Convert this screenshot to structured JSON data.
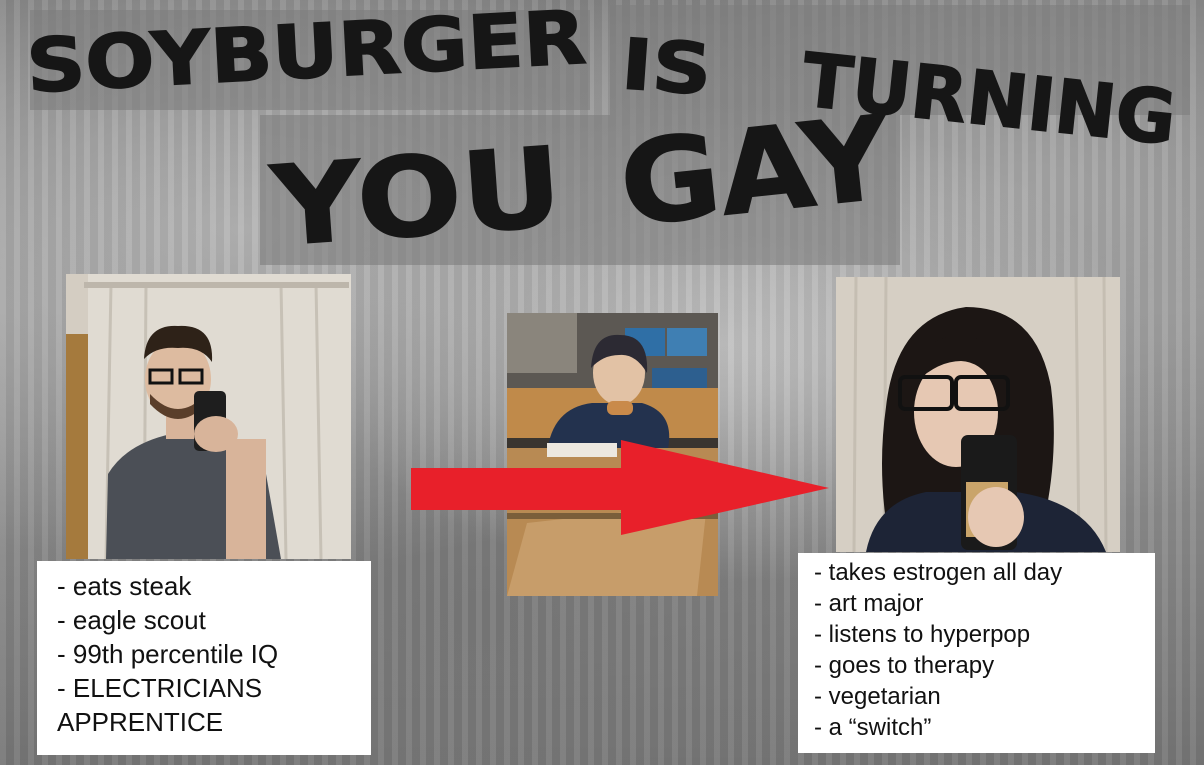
{
  "title": {
    "line1_words": [
      "SOYBURGER",
      "IS",
      "TURNING"
    ],
    "line2_words": [
      "YOU",
      "GAY"
    ]
  },
  "left_panel": {
    "image_alt": "young man with glasses taking mirror selfie in grey shirt",
    "traits": [
      "- eats steak",
      "- eagle scout",
      "- 99th percentile IQ",
      "- ELECTRICIANS",
      "APPRENTICE"
    ]
  },
  "middle_panel": {
    "image_alt": "person eating a burger at a restaurant table"
  },
  "arrow": {
    "color": "#e8202a",
    "direction": "right"
  },
  "right_panel": {
    "image_alt": "person with long dark hair and glasses taking mirror selfie",
    "traits": [
      "- takes estrogen all day",
      "- art major",
      "- listens to hyperpop",
      "- goes to therapy",
      "- vegetarian",
      "- a “switch”"
    ]
  }
}
